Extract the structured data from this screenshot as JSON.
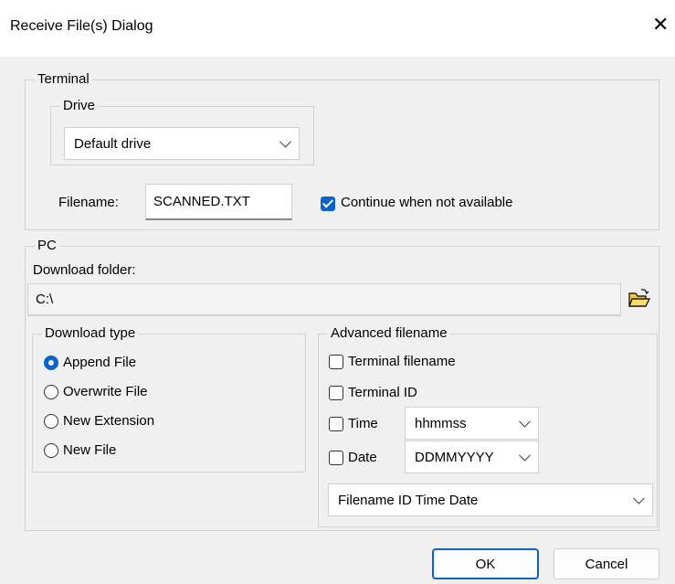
{
  "window": {
    "title": "Receive File(s) Dialog",
    "close_glyph": "✕"
  },
  "terminal": {
    "group_label": "Terminal",
    "drive_group_label": "Drive",
    "drive_value": "Default drive",
    "filename_label": "Filename:",
    "filename_value": "SCANNED.TXT",
    "continue_label": "Continue when not available",
    "continue_checked": true
  },
  "pc": {
    "group_label": "PC",
    "download_folder_label": "Download folder:",
    "download_folder_value": "C:\\",
    "download_type": {
      "label": "Download type",
      "options": [
        "Append File",
        "Overwrite File",
        "New Extension",
        "New File"
      ],
      "selected": "Append File"
    },
    "advanced": {
      "label": "Advanced filename",
      "terminal_filename_label": "Terminal filename",
      "terminal_id_label": "Terminal ID",
      "time_label": "Time",
      "time_format": "hhmmss",
      "date_label": "Date",
      "date_format": "DDMMYYYY",
      "order_value": "Filename ID Time Date"
    }
  },
  "buttons": {
    "ok": "OK",
    "cancel": "Cancel"
  },
  "colors": {
    "accent": "#0a63c9",
    "background": "#f0f0f0"
  }
}
